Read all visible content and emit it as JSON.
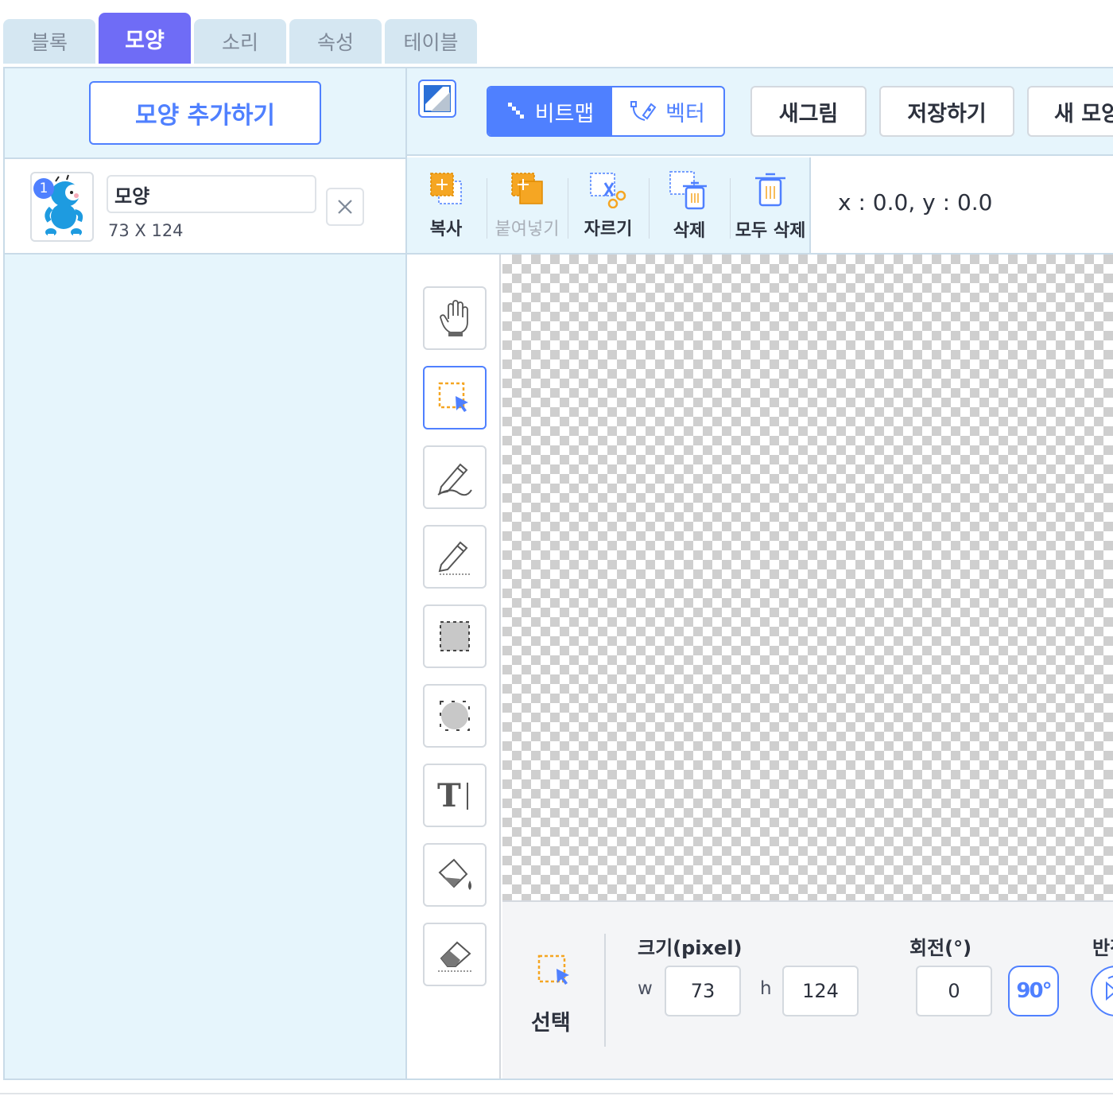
{
  "tabs": [
    {
      "label": "블록",
      "active": false
    },
    {
      "label": "모양",
      "active": true
    },
    {
      "label": "소리",
      "active": false
    },
    {
      "label": "속성",
      "active": false
    },
    {
      "label": "테이블",
      "active": false
    }
  ],
  "left_panel": {
    "add_button": "모양 추가하기",
    "shapes": [
      {
        "index": "1",
        "name": "모양",
        "size": "73 X 124",
        "icon": "character-thumbnail"
      }
    ]
  },
  "top_bar": {
    "mode_bitmap": "비트맵",
    "mode_vector": "벡터",
    "active_mode": "bitmap",
    "new_drawing": "새그림",
    "save": "저장하기",
    "new_shape": "새 모양"
  },
  "edit_tools": [
    {
      "label": "복사",
      "icon": "copy-icon",
      "enabled": true
    },
    {
      "label": "붙여넣기",
      "icon": "paste-icon",
      "enabled": false
    },
    {
      "label": "자르기",
      "icon": "cut-icon",
      "enabled": true
    },
    {
      "label": "삭제",
      "icon": "delete-icon",
      "enabled": true
    },
    {
      "label": "모두 삭제",
      "icon": "delete-all-icon",
      "enabled": true
    }
  ],
  "coordinates": "x : 0.0, y : 0.0",
  "tools": [
    {
      "icon": "hand-icon",
      "active": false
    },
    {
      "icon": "select-icon",
      "active": true
    },
    {
      "icon": "pen-icon",
      "active": false
    },
    {
      "icon": "line-icon",
      "active": false
    },
    {
      "icon": "rectangle-icon",
      "active": false
    },
    {
      "icon": "circle-icon",
      "active": false
    },
    {
      "icon": "text-icon",
      "active": false
    },
    {
      "icon": "fill-icon",
      "active": false
    },
    {
      "icon": "eraser-icon",
      "active": false
    }
  ],
  "properties": {
    "tool_label": "선택",
    "size_title": "크기(pixel)",
    "w_label": "w",
    "w_value": "73",
    "h_label": "h",
    "h_value": "124",
    "rotation_title": "회전(°)",
    "rotation_value": "0",
    "rotate_button": "90°",
    "flip_title": "반전"
  },
  "colors": {
    "accent": "#4f80ff",
    "active_tab": "#6f6cf6",
    "panel_bg": "#e6f5fc",
    "orange": "#f5a623"
  }
}
